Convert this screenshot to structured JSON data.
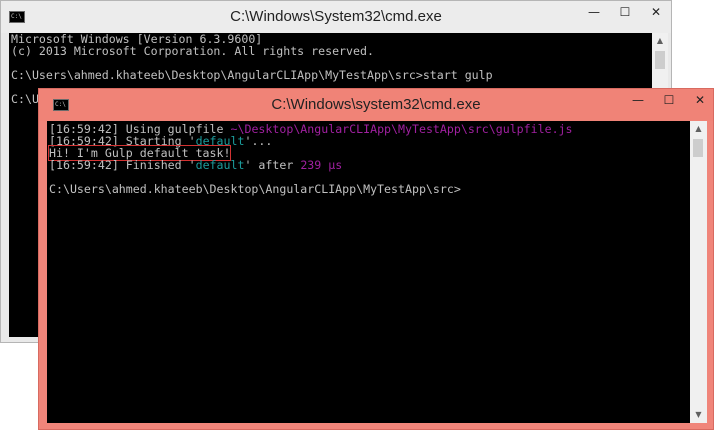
{
  "back_window": {
    "title": "C:\\Windows\\System32\\cmd.exe",
    "lines": [
      "Microsoft Windows [Version 6.3.9600]",
      "(c) 2013 Microsoft Corporation. All rights reserved.",
      "C:\\Users\\ahmed.khateeb\\Desktop\\AngularCLIApp\\MyTestApp\\src>start gulp",
      "C:\\U"
    ]
  },
  "front_window": {
    "title": "C:\\Windows\\system32\\cmd.exe",
    "using": {
      "time": "[16:59:42]",
      "text": " Using gulpfile ",
      "path": "~\\Desktop\\AngularCLIApp\\MyTestApp\\src\\gulpfile.js"
    },
    "starting": {
      "time": "[16:59:42]",
      "pre": " Starting '",
      "task": "default",
      "post": "'..."
    },
    "message": "Hi! I'm Gulp default task!",
    "finished": {
      "time": "[16:59:42]",
      "pre": " Finished '",
      "task": "default",
      "mid": "' after ",
      "duration": "239 μs"
    },
    "prompt": "C:\\Users\\ahmed.khateeb\\Desktop\\AngularCLIApp\\MyTestApp\\src>"
  },
  "controls": {
    "minimize": "—",
    "maximize": "☐",
    "close": "✕"
  },
  "icon_label": "C:\\",
  "colors": {
    "front_frame": "#f0857a",
    "path": "#a020a0",
    "task": "#1c9c9c",
    "highlight": "#d23232"
  }
}
